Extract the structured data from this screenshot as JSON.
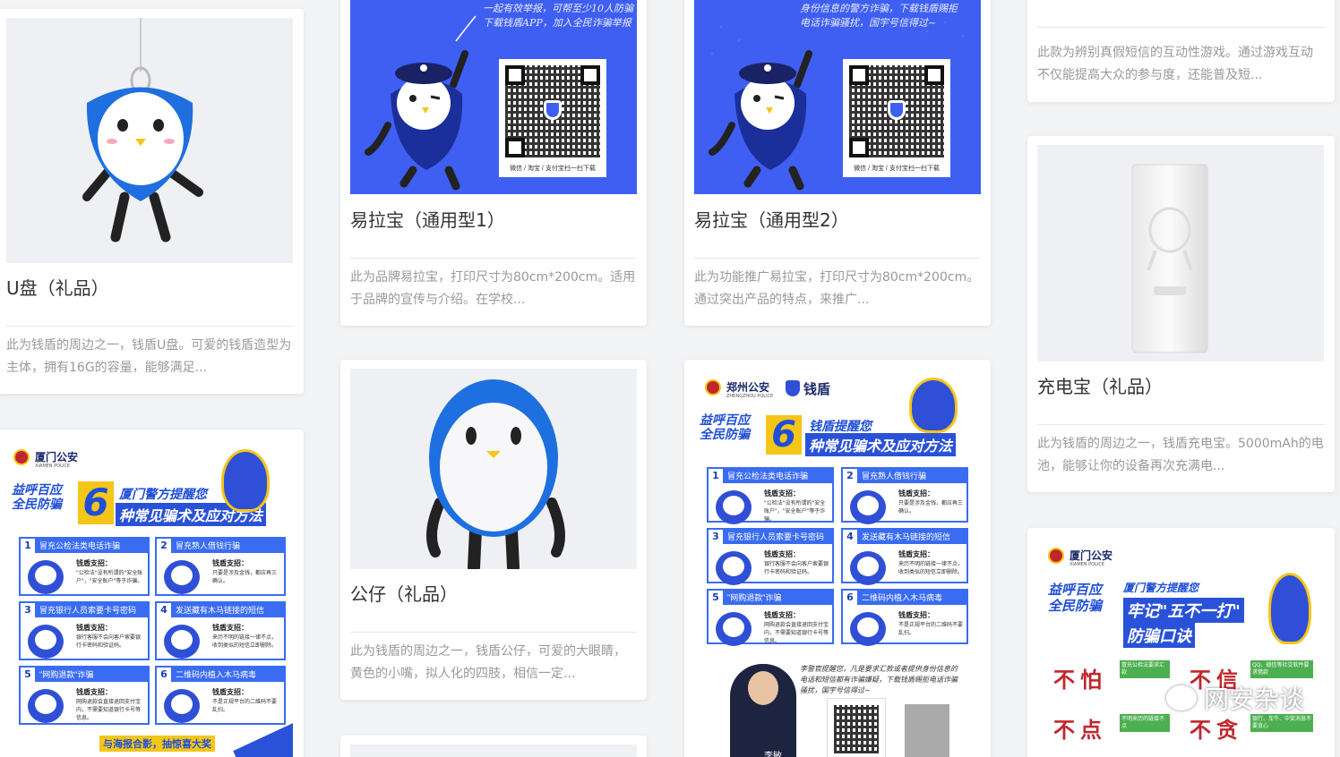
{
  "cards": [
    {
      "id": "usb",
      "title": "U盘（礼品）",
      "desc": "此为钱盾的周边之一，钱盾U盘。可爱的钱盾造型为主体，拥有16G的容量，能够满足..."
    },
    {
      "id": "rollup1",
      "title": "易拉宝（通用型1）",
      "desc": "此为品牌易拉宝，打印尺寸为80cm*200cm。适用于品牌的宣传与介绍。在学校...",
      "poster_text": [
        "一起有效举报，可帮至少10人防骗",
        "下载钱盾APP，加入全民诈骗举报"
      ],
      "qr_caption": "微信 / 淘宝 / 支付宝扫一扫下载"
    },
    {
      "id": "rollup2",
      "title": "易拉宝（通用型2）",
      "desc": "此为功能推广易拉宝，打印尺寸为80cm*200cm。通过突出产品的特点，来推广...",
      "poster_text": [
        "身份信息的警方诈骗，下载钱盾赐拒",
        "电话诈骗骚扰，国宇号信得过~"
      ],
      "qr_caption": "微信 / 淘宝 / 支付宝扫一扫下载"
    },
    {
      "id": "game",
      "desc": "此款为辨别真假短信的互动性游戏。通过游戏互动不仅能提高大众的参与度，还能普及短..."
    },
    {
      "id": "powerbank",
      "title": "充电宝（礼品）",
      "desc": "此为钱盾的周边之一，钱盾充电宝。5000mAh的电池，能够让你的设备再次充满电..."
    },
    {
      "id": "doll",
      "title": "公仔（礼品）",
      "desc": "此为钱盾的周边之一，钱盾公仔，可爱的大眼睛，黄色的小嘴，拟人化的四肢，相信一定..."
    }
  ],
  "posters": {
    "xiamen1": {
      "org": "厦门公安",
      "org_en": "XIAMEN POLICE",
      "slogan": "益呼百应 全民防骗",
      "big_num": "6",
      "head1": "厦门警方提醒您",
      "head2": "种常见骗术及应对方法",
      "items": [
        {
          "n": "1",
          "t": "冒充公检法类电话诈骗",
          "sub": "钱盾支招：",
          "body": "\"公检法\"没有所谓的\"安全账户\"，\"安全账户\"等于诈骗。"
        },
        {
          "n": "2",
          "t": "冒充熟人借钱行骗",
          "sub": "钱盾支招：",
          "body": "只要是涉及金钱，都应再三确认。"
        },
        {
          "n": "3",
          "t": "冒充银行人员索要卡号密码",
          "sub": "钱盾支招：",
          "body": "银行客服不会向客户索要银行卡密码和验证码。"
        },
        {
          "n": "4",
          "t": "发送藏有木马链接的短信",
          "sub": "钱盾支招：",
          "body": "来历不明的链接一律不点，收到类似的短信立即删除。"
        },
        {
          "n": "5",
          "t": "\"网购退款\"诈骗",
          "sub": "钱盾支招：",
          "body": "网购退款会直接退回支付宝内，不需要知道银行卡号等信息。"
        },
        {
          "n": "6",
          "t": "二维码内植入木马病毒",
          "sub": "钱盾支招：",
          "body": "不是正规平台的二维码不要乱扫。"
        }
      ],
      "footer": "与海报合影，抽惊喜大奖"
    },
    "zhengzhou": {
      "org": "郑州公安",
      "org_en": "ZHENGZHOU POLICE",
      "brand": "钱盾",
      "slogan": "益呼百应 全民防骗",
      "big_num": "6",
      "head1": "钱盾提醒您",
      "head2": "种常见骗术及应对方法",
      "items": [
        {
          "n": "1",
          "t": "冒充公检法类电话诈骗",
          "sub": "钱盾支招：",
          "body": "\"公检法\"没有所谓的\"安全账户\"，\"安全账户\"等于诈骗。"
        },
        {
          "n": "2",
          "t": "冒充熟人借钱行骗",
          "sub": "钱盾支招：",
          "body": "只要是涉及金钱，都应再三确认。"
        },
        {
          "n": "3",
          "t": "冒充银行人员索要卡号密码",
          "sub": "钱盾支招：",
          "body": "银行客服不会向客户索要银行卡密码和验证码。"
        },
        {
          "n": "4",
          "t": "发送藏有木马链接的短信",
          "sub": "钱盾支招：",
          "body": "来历不明的链接一律不点，收到类似的短信立即删除。"
        },
        {
          "n": "5",
          "t": "\"网购退款\"诈骗",
          "sub": "钱盾支招：",
          "body": "网购退款会直接退回支付宝内，不需要知道银行卡号等信息。"
        },
        {
          "n": "6",
          "t": "二维码内植入木马病毒",
          "sub": "钱盾支招：",
          "body": "不是正规平台的二维码不要乱扫。"
        }
      ],
      "quote": "李警官提醒您，凡是要求汇款或者提供身份信息的电话和短信都有诈骗嫌疑，下载钱盾赐拒电话诈骗骚扰，国宇号信得过~",
      "person": "李敏"
    },
    "xiamen2": {
      "org": "厦门公安",
      "org_en": "XIAMEN POLICE",
      "slogan": "益呼百应 全民防骗",
      "head1": "厦门警方提醒您",
      "head2": "牢记\"五不一打\"",
      "head3": "防骗口诀",
      "chars": [
        "不",
        "怕",
        "不",
        "信",
        "不",
        "点",
        "不",
        "贪"
      ],
      "notes": [
        "冒充公检法要求汇款",
        "QQ、微信等社交软件要求借款",
        "不明来历的链接不点",
        "银行、车牛、中奖消息不要贪心"
      ]
    }
  },
  "watermark": "网安杂谈"
}
